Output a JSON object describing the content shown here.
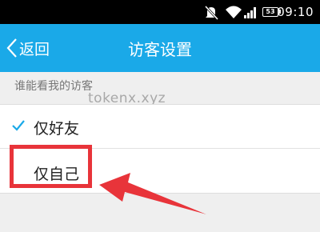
{
  "status_bar": {
    "battery": "53",
    "time": "09:10",
    "icons": [
      "mute-icon",
      "wifi-icon",
      "signal-icon",
      "battery-icon"
    ]
  },
  "nav": {
    "back_label": "返回",
    "title": "访客设置",
    "color": "#1aa9e8"
  },
  "section": {
    "header": "谁能看我的访客"
  },
  "watermark": "tokenx.xyz",
  "options": [
    {
      "label": "仅好友",
      "selected": true
    },
    {
      "label": "仅自己",
      "selected": false
    }
  ],
  "annotation": {
    "highlight_color": "#e8343a"
  }
}
